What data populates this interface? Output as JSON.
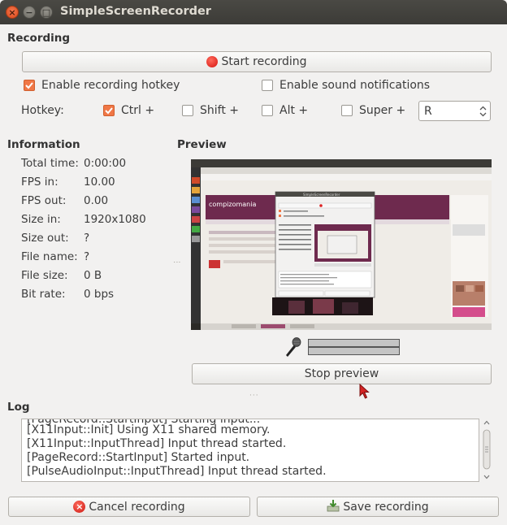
{
  "window": {
    "title": "SimpleScreenRecorder"
  },
  "recording": {
    "heading": "Recording",
    "start_label": "Start recording",
    "enable_hotkey_label": "Enable recording hotkey",
    "enable_hotkey_checked": true,
    "enable_sound_label": "Enable sound notifications",
    "enable_sound_checked": false,
    "hotkey_label": "Hotkey:",
    "ctrl_label": "Ctrl +",
    "ctrl_checked": true,
    "shift_label": "Shift +",
    "shift_checked": false,
    "alt_label": "Alt +",
    "alt_checked": false,
    "super_label": "Super +",
    "super_checked": false,
    "key_value": "R"
  },
  "information": {
    "heading": "Information",
    "rows": [
      {
        "key": "Total time:",
        "value": "0:00:00"
      },
      {
        "key": "FPS in:",
        "value": "10.00"
      },
      {
        "key": "FPS out:",
        "value": "0.00"
      },
      {
        "key": "Size in:",
        "value": "1920x1080"
      },
      {
        "key": "Size out:",
        "value": "?"
      },
      {
        "key": "File name:",
        "value": "?"
      },
      {
        "key": "File size:",
        "value": "0 B"
      },
      {
        "key": "Bit rate:",
        "value": "0 bps"
      }
    ]
  },
  "preview": {
    "heading": "Preview",
    "stop_label": "Stop preview",
    "thumb_site_title": "compizomania",
    "thumb_ssr_title": "SimpleScreenRecorder"
  },
  "log": {
    "heading": "Log",
    "partial_line": "[PageRecord::StartInput] Starting input...",
    "lines": [
      "[X11Input::Init] Using X11 shared memory.",
      "[X11Input::InputThread] Input thread started.",
      "[PageRecord::StartInput] Started input.",
      "[PulseAudioInput::InputThread] Input thread started."
    ]
  },
  "footer": {
    "cancel_label": "Cancel recording",
    "save_label": "Save recording"
  },
  "colors": {
    "accent": "#f07746",
    "titlebar": "#3c3b37",
    "record_red": "#e0201b"
  }
}
